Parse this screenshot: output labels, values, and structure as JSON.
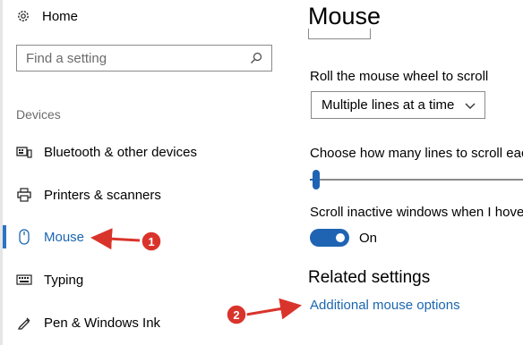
{
  "sidebar": {
    "home": {
      "label": "Home",
      "icon": "gear-icon"
    },
    "search": {
      "placeholder": "Find a setting",
      "icon": "search-icon"
    },
    "section_title": "Devices",
    "items": [
      {
        "label": "Bluetooth & other devices",
        "icon": "devices-icon"
      },
      {
        "label": "Printers & scanners",
        "icon": "printer-icon"
      },
      {
        "label": "Mouse",
        "icon": "mouse-icon",
        "selected": true
      },
      {
        "label": "Typing",
        "icon": "keyboard-icon"
      },
      {
        "label": "Pen & Windows Ink",
        "icon": "pen-icon"
      }
    ]
  },
  "main": {
    "title": "Mouse",
    "scroll_label": "Roll the mouse wheel to scroll",
    "scroll_select_value": "Multiple lines at a time",
    "lines_label": "Choose how many lines to scroll eac",
    "lines_slider_level": 0.02,
    "inactive_label": "Scroll inactive windows when I hove",
    "toggle_state": "On",
    "related_heading": "Related settings",
    "related_link": "Additional mouse options"
  },
  "annotations": [
    {
      "number": "1",
      "points_to": "Mouse"
    },
    {
      "number": "2",
      "points_to": "Additional mouse options"
    }
  ],
  "colors": {
    "accent": "#1a66b0",
    "toggle_on": "#1f64b3",
    "annotation_red": "#d9342b"
  }
}
